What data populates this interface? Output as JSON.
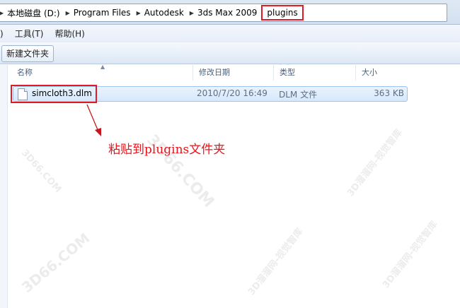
{
  "breadcrumb": {
    "items": [
      "本地磁盘 (D:)",
      "Program Files",
      "Autodesk",
      "3ds Max 2009",
      "plugins"
    ]
  },
  "menu": {
    "items": [
      "/)",
      "工具(T)",
      "帮助(H)"
    ]
  },
  "toolbar": {
    "new_folder_label": "新建文件夹"
  },
  "columns": {
    "name": "名称",
    "modified": "修改日期",
    "type": "类型",
    "size": "大小"
  },
  "files": [
    {
      "name": "simcloth3.dlm",
      "modified": "2010/7/20 16:49",
      "type": "DLM 文件",
      "size": "363 KB"
    }
  ],
  "annotation": {
    "text": "粘贴到plugins文件夹",
    "color": "#e8141c"
  },
  "watermarks": [
    "3D66.COM",
    "3D66.COM",
    "3D66.COM",
    "3D溜溜网-视觉智库",
    "3D溜溜网-视觉智库",
    "3D溜溜网-视觉智库",
    "3D66.COM"
  ],
  "colors": {
    "highlight_box": "#e21a23",
    "selection": "#d6e8fb"
  }
}
